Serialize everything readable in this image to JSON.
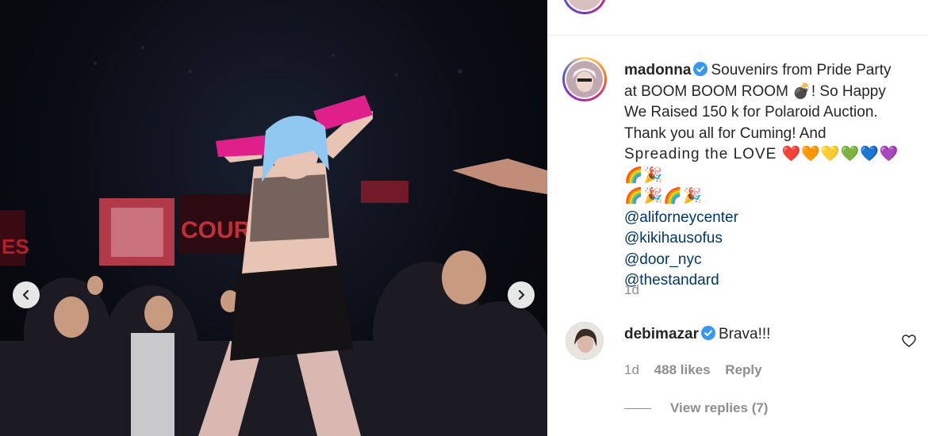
{
  "post": {
    "username": "madonna",
    "caption_lines": [
      "Souvenirs from Pride Party",
      "at BOOM BOOM ROOM 💣! So Happy",
      "We Raised 150 k for Polaroid Auction.",
      "Thank you all for Cuming! And",
      "Spreading the LOVE ❤️🧡💛💚💙💜🌈🎉",
      "🌈🎉🌈🎉"
    ],
    "mentions": [
      "@aliforneycenter",
      "@kikihausofus",
      "@door_nyc",
      "@thestandard"
    ],
    "time": "1d"
  },
  "photo": {
    "screen_text": "COURAGE",
    "edge_text": "ES"
  },
  "comment": {
    "username": "debimazar",
    "text": "Brava!!!",
    "time": "1d",
    "likes": "488 likes",
    "reply_label": "Reply",
    "view_replies": "View replies (7)"
  },
  "colors": {
    "verified": "#3897f0",
    "mention": "#00376b",
    "muted": "#8e8e8e",
    "glove": "#e0208a",
    "hair": "#8fc8f0"
  }
}
